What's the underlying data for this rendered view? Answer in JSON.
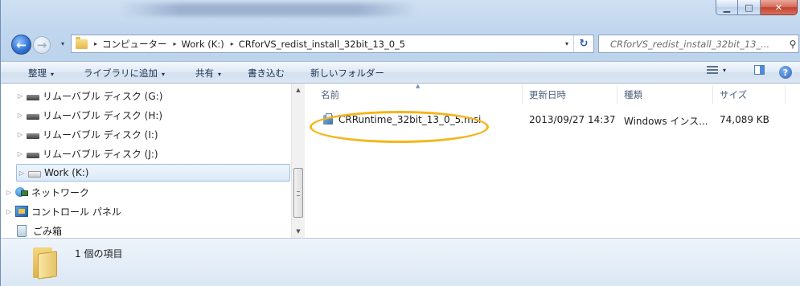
{
  "window": {
    "minimize_glyph": "▁",
    "maximize_glyph": "□",
    "close_glyph": "✕"
  },
  "address_bar": {
    "breadcrumbs": [
      "コンピューター",
      "Work (K:)",
      "CRforVS_redist_install_32bit_13_0_5"
    ],
    "separator": "▸",
    "dropdown_glyph": "▾",
    "refresh_glyph": "↻"
  },
  "search": {
    "placeholder": "CRforVS_redist_install_32bit_13_...",
    "icon": "search-icon"
  },
  "toolbar": {
    "organize": "整理",
    "add_to_library": "ライブラリに追加",
    "share": "共有",
    "burn": "書き込む",
    "new_folder": "新しいフォルダー",
    "caret": "▾"
  },
  "nav_pane": {
    "items": [
      {
        "label": "リムーバブル ディスク (G:)",
        "icon": "drive-icon"
      },
      {
        "label": "リムーバブル ディスク (H:)",
        "icon": "drive-icon"
      },
      {
        "label": "リムーバブル ディスク (I:)",
        "icon": "drive-icon"
      },
      {
        "label": "リムーバブル ディスク (J:)",
        "icon": "drive-icon"
      },
      {
        "label": "Work (K:)",
        "icon": "drive-icon",
        "selected": true
      },
      {
        "label": "ネットワーク",
        "icon": "network-icon"
      },
      {
        "label": "コントロール パネル",
        "icon": "control-panel-icon"
      },
      {
        "label": "ごみ箱",
        "icon": "recycle-bin-icon"
      }
    ]
  },
  "file_list": {
    "columns": [
      "名前",
      "更新日時",
      "種類",
      "サイズ"
    ],
    "rows": [
      {
        "name": "CRRuntime_32bit_13_0_5.msi",
        "modified": "2013/09/27 14:37",
        "type": "Windows インス...",
        "size": "74,089 KB",
        "icon": "msi-installer-icon"
      }
    ],
    "highlight_color": "#f5b51a"
  },
  "status": {
    "item_count": "1 個の項目"
  }
}
